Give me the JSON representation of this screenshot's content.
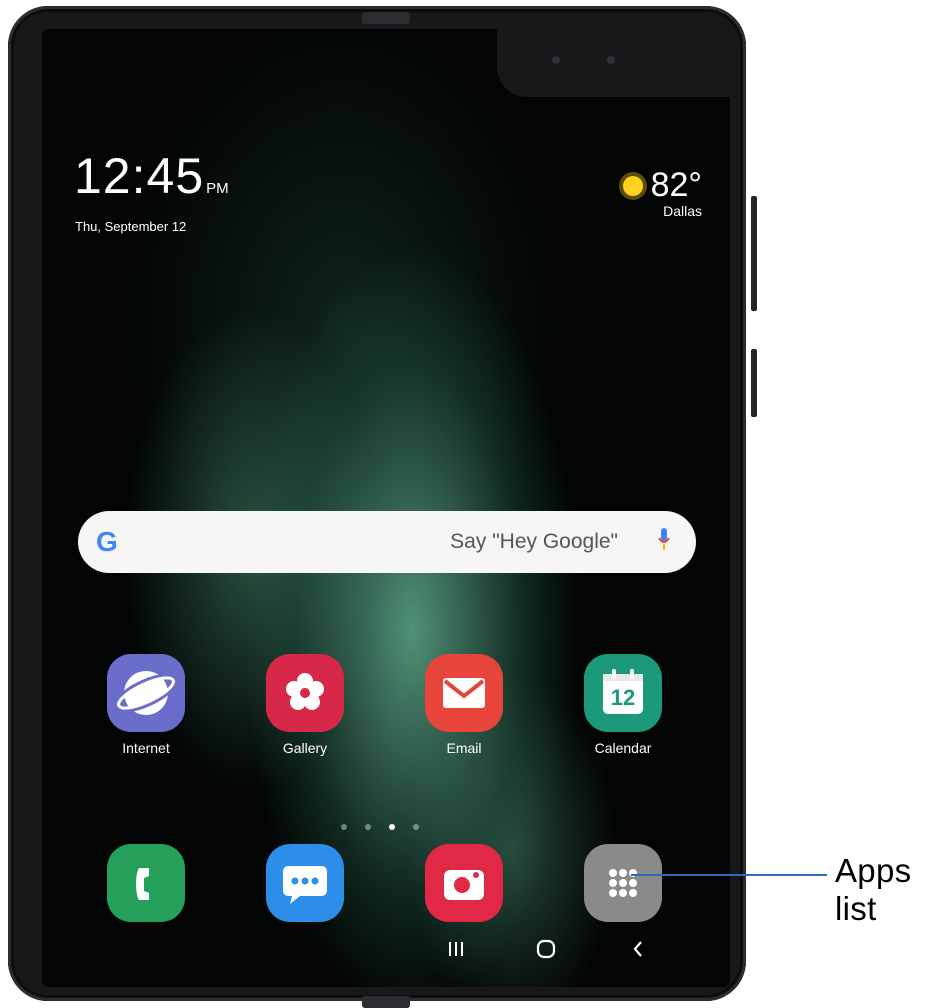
{
  "status": {
    "time": "12:45",
    "ampm": "PM",
    "date": "Thu, September 12",
    "weather": {
      "temperature": "82°",
      "city": "Dallas",
      "icon": "sun-icon"
    }
  },
  "search": {
    "placeholder": "Say \"Hey Google\"",
    "logo": "G"
  },
  "home_apps": [
    {
      "label": "Internet",
      "icon": "internet-icon",
      "color": "#6b6dcb"
    },
    {
      "label": "Gallery",
      "icon": "gallery-icon",
      "color": "#d8284a"
    },
    {
      "label": "Email",
      "icon": "email-icon",
      "color": "#e7453c"
    },
    {
      "label": "Calendar",
      "icon": "calendar-icon",
      "color": "#1b9a7a",
      "badge": "12"
    }
  ],
  "dock_apps": [
    {
      "icon": "phone-icon",
      "color": "#24a05a"
    },
    {
      "icon": "messages-icon",
      "color": "#2c8ee8"
    },
    {
      "icon": "camera-icon",
      "color": "#e12846"
    },
    {
      "icon": "apps-grid-icon",
      "color": "#8a8a8a"
    }
  ],
  "nav": {
    "recent": "|||",
    "home": "○",
    "back": "‹"
  },
  "annotation": {
    "label": "Apps list"
  }
}
